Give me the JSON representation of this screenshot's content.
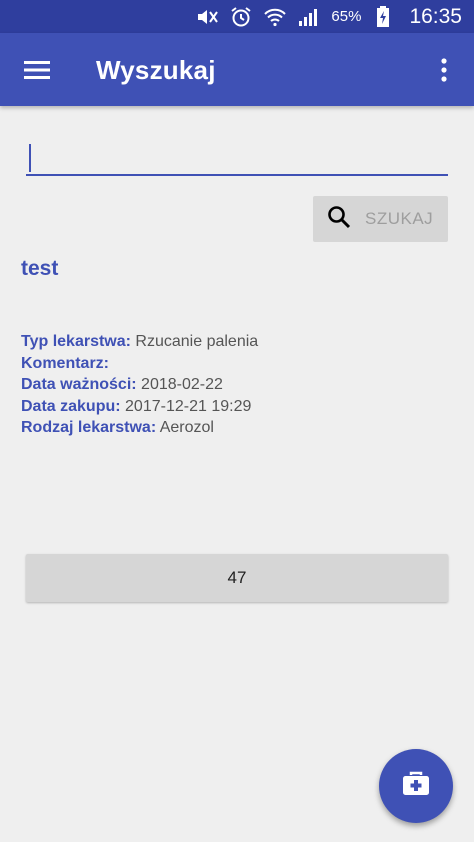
{
  "status_bar": {
    "battery_percent": "65%",
    "time": "16:35",
    "icons": [
      "mute-icon",
      "alarm-icon",
      "wifi-icon",
      "signal-icon",
      "battery-charging-icon"
    ]
  },
  "app_bar": {
    "title": "Wyszukaj",
    "menu_icon": "hamburger-icon",
    "overflow_icon": "more-vert-icon"
  },
  "search": {
    "value": "",
    "button_label": "SZUKAJ",
    "button_icon": "search-icon"
  },
  "result": {
    "name": "test",
    "fields": [
      {
        "label": "Typ lekarstwa:",
        "value": "Rzucanie palenia"
      },
      {
        "label": "Komentarz:",
        "value": ""
      },
      {
        "label": "Data ważności:",
        "value": "2018-02-22"
      },
      {
        "label": "Data zakupu:",
        "value": "2017-12-21 19:29"
      },
      {
        "label": "Rodzaj lekarstwa:",
        "value": "Aerozol"
      }
    ]
  },
  "count_button": {
    "label": "47"
  },
  "fab": {
    "icon": "medical-kit-add-icon"
  },
  "colors": {
    "primary": "#3f51b5",
    "primary_dark": "#2f3e9e",
    "background": "#efefef",
    "button_grey": "#d6d6d6"
  }
}
